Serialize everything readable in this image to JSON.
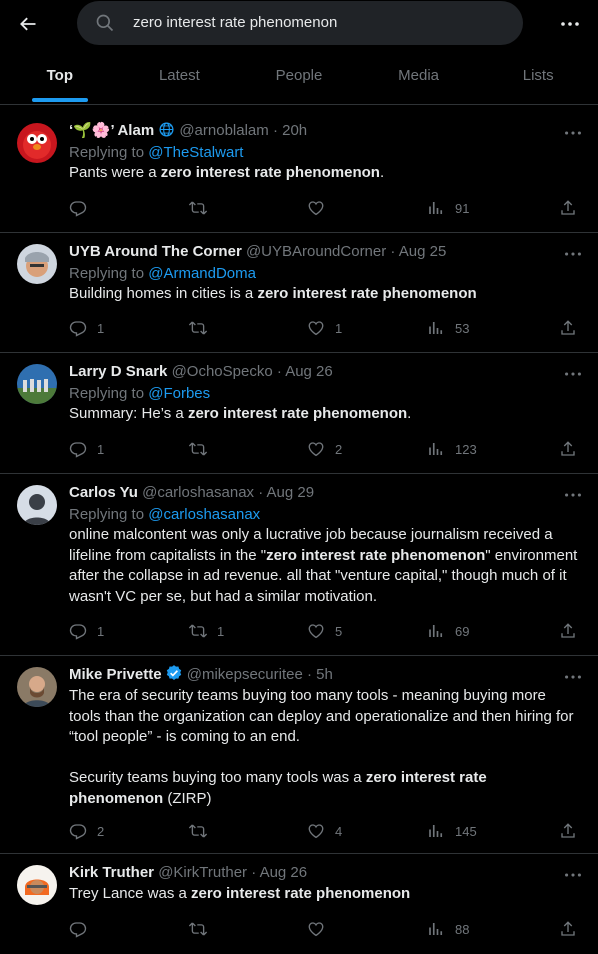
{
  "search": {
    "query": "zero interest rate phenomenon"
  },
  "tabs": [
    {
      "label": "Top",
      "active": true
    },
    {
      "label": "Latest"
    },
    {
      "label": "People"
    },
    {
      "label": "Media"
    },
    {
      "label": "Lists"
    }
  ],
  "tweets": [
    {
      "name": "‘🌱🌸’ Alam",
      "handle": "@arnoblalam",
      "time": "· 20h",
      "replying_prefix": "Replying to ",
      "replying_to": "@TheStalwart",
      "text_before": "Pants were a ",
      "text_bold": "zero interest rate phenomenon",
      "text_after": ".",
      "replies": "",
      "retweets": "",
      "likes": "",
      "views": "91"
    },
    {
      "name": "UYB Around The Corner",
      "handle": "@UYBAroundCorner",
      "time": "· Aug 25",
      "replying_prefix": "Replying to ",
      "replying_to": "@ArmandDoma",
      "text_before": "Building homes in cities is a ",
      "text_bold": "zero interest rate phenomenon",
      "text_after": "",
      "replies": "1",
      "retweets": "",
      "likes": "1",
      "views": "53"
    },
    {
      "name": "Larry D Snark",
      "handle": "@OchoSpecko",
      "time": "· Aug 26",
      "replying_prefix": "Replying to ",
      "replying_to": "@Forbes",
      "text_before": "Summary: He’s a ",
      "text_bold": "zero interest rate phenomenon",
      "text_after": ".",
      "replies": "1",
      "retweets": "",
      "likes": "2",
      "views": "123"
    },
    {
      "name": "Carlos Yu",
      "handle": "@carloshasanax",
      "time": "· Aug 29",
      "replying_prefix": "Replying to ",
      "replying_to": "@carloshasanax",
      "text_before": "online malcontent was only a lucrative job because journalism received a lifeline from capitalists in the \"",
      "text_bold": "zero interest rate phenomenon",
      "text_after": "\" environment after the collapse in ad revenue. all that \"venture capital,\" though much of it wasn't VC per se, but had a similar motivation.",
      "replies": "1",
      "retweets": "1",
      "likes": "5",
      "views": "69"
    },
    {
      "name": "Mike Privette",
      "handle": "@mikepsecuritee",
      "time": "· 5h",
      "text_before": "The era of security teams buying too many tools - meaning buying more tools than the organization can deploy and operationalize and then hiring for “tool people” - is coming to an end.\n\nSecurity teams buying too many tools was a ",
      "text_bold": "zero interest rate phenomenon",
      "text_after": " (ZIRP)",
      "replies": "2",
      "retweets": "",
      "likes": "4",
      "views": "145"
    },
    {
      "name": "Kirk Truther",
      "handle": "@KirkTruther",
      "time": "· Aug 26",
      "text_before": "Trey Lance was a ",
      "text_bold": "zero interest rate phenomenon",
      "text_after": "",
      "replies": "",
      "retweets": "",
      "likes": "",
      "views": "88"
    }
  ],
  "colors": {
    "accent": "#1d9bf0",
    "muted": "#71767b",
    "border": "#2f3336",
    "text": "#e7e9ea"
  }
}
